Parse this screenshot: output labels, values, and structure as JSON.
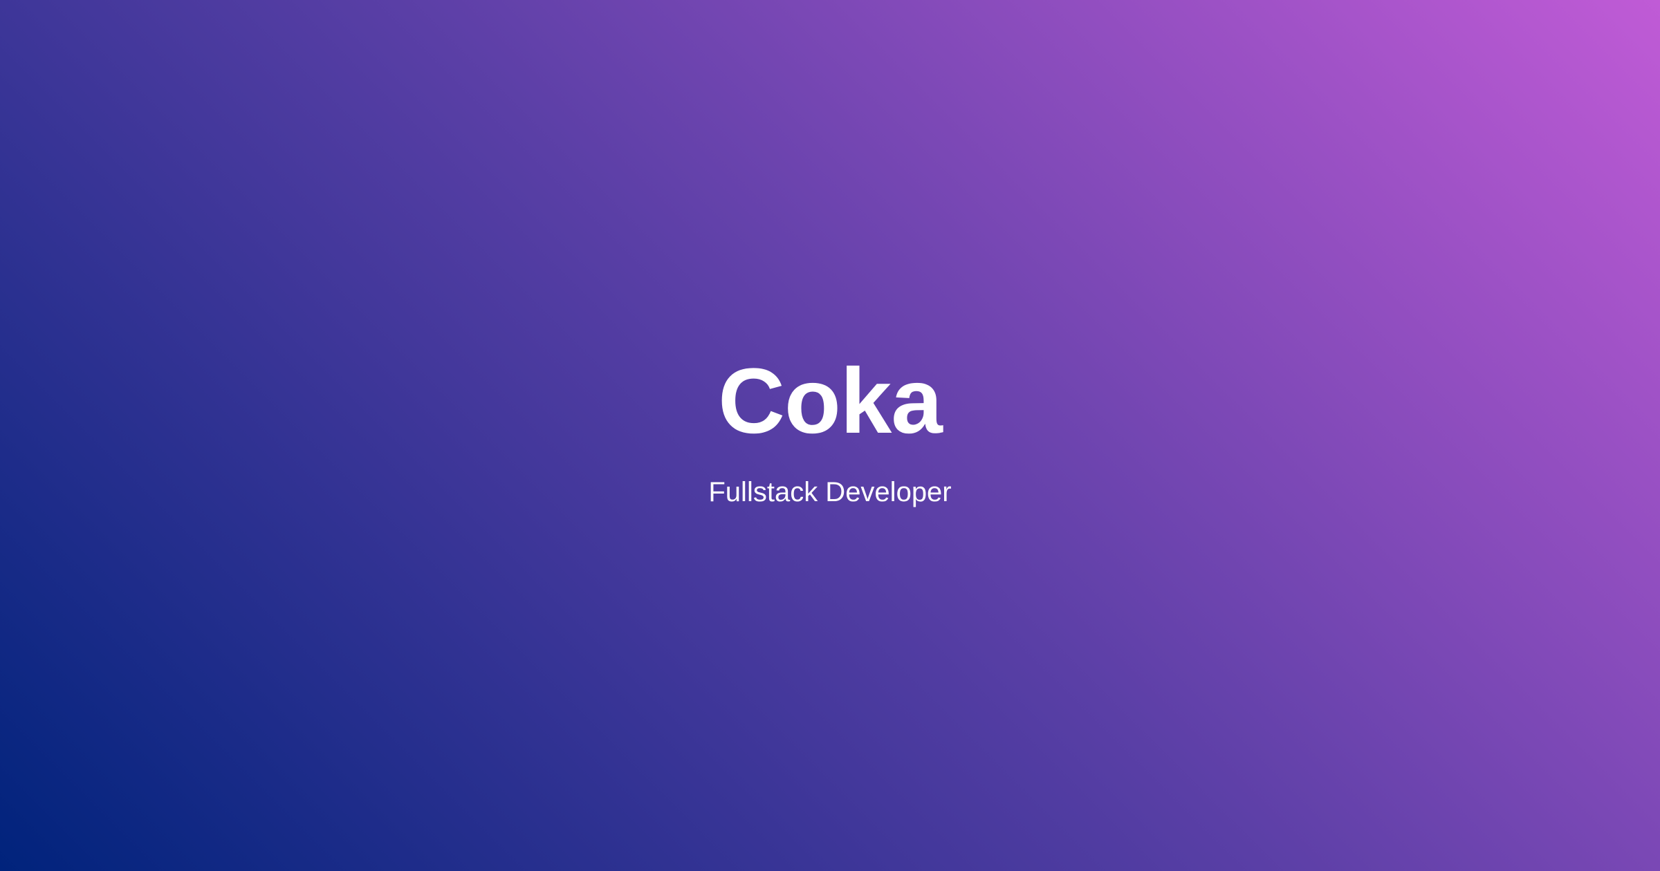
{
  "hero": {
    "title": "Coka",
    "subtitle": "Fullstack Developer"
  },
  "colors": {
    "gradient_start": "#00237c",
    "gradient_mid": "#5a3fa6",
    "gradient_end": "#c05bd6",
    "text": "#ffffff"
  }
}
